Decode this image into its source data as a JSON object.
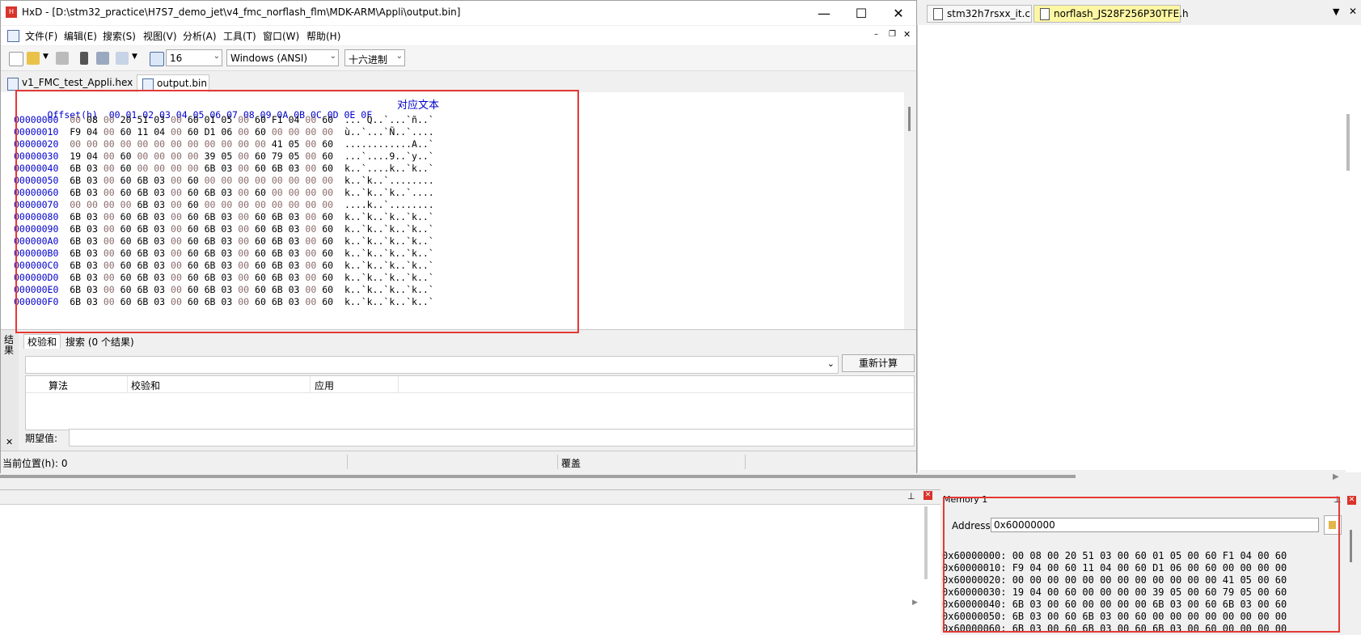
{
  "hxd": {
    "title": "HxD - [D:\\stm32_practice\\H7S7_demo_jet\\v4_fmc_norflash_flm\\MDK-ARM\\Appli\\output.bin]",
    "minimize": "—",
    "maximize": "☐",
    "close": "✕",
    "menu": [
      "文件(F)",
      "编辑(E)",
      "搜索(S)",
      "视图(V)",
      "分析(A)",
      "工具(T)",
      "窗口(W)",
      "帮助(H)"
    ],
    "bytes_per_row": "16",
    "encoding": "Windows (ANSI)",
    "number_base": "十六进制",
    "tabs": [
      "v1_FMC_test_Appli.hex",
      "output.bin"
    ],
    "hex_header": {
      "offset": "Offset(h)",
      "cols": "00 01 02 03 04 05 06 07 08 09 0A 0B 0C 0D 0E 0F",
      "text": "对应文本"
    },
    "rows": [
      {
        "off": "00000000",
        "hex": [
          "00",
          "08",
          "00",
          "20",
          "51",
          "03",
          "00",
          "60",
          "01",
          "05",
          "00",
          "60",
          "F1",
          "04",
          "00",
          "60"
        ],
        "txt": "... Q..`...`ñ..`"
      },
      {
        "off": "00000010",
        "hex": [
          "F9",
          "04",
          "00",
          "60",
          "11",
          "04",
          "00",
          "60",
          "D1",
          "06",
          "00",
          "60",
          "00",
          "00",
          "00",
          "00"
        ],
        "txt": "ù..`...`Ñ..`...."
      },
      {
        "off": "00000020",
        "hex": [
          "00",
          "00",
          "00",
          "00",
          "00",
          "00",
          "00",
          "00",
          "00",
          "00",
          "00",
          "00",
          "41",
          "05",
          "00",
          "60"
        ],
        "txt": "............A..`"
      },
      {
        "off": "00000030",
        "hex": [
          "19",
          "04",
          "00",
          "60",
          "00",
          "00",
          "00",
          "00",
          "39",
          "05",
          "00",
          "60",
          "79",
          "05",
          "00",
          "60"
        ],
        "txt": "...`....9..`y..`"
      },
      {
        "off": "00000040",
        "hex": [
          "6B",
          "03",
          "00",
          "60",
          "00",
          "00",
          "00",
          "00",
          "6B",
          "03",
          "00",
          "60",
          "6B",
          "03",
          "00",
          "60"
        ],
        "txt": "k..`....k..`k..`"
      },
      {
        "off": "00000050",
        "hex": [
          "6B",
          "03",
          "00",
          "60",
          "6B",
          "03",
          "00",
          "60",
          "00",
          "00",
          "00",
          "00",
          "00",
          "00",
          "00",
          "00"
        ],
        "txt": "k..`k..`........"
      },
      {
        "off": "00000060",
        "hex": [
          "6B",
          "03",
          "00",
          "60",
          "6B",
          "03",
          "00",
          "60",
          "6B",
          "03",
          "00",
          "60",
          "00",
          "00",
          "00",
          "00"
        ],
        "txt": "k..`k..`k..`...."
      },
      {
        "off": "00000070",
        "hex": [
          "00",
          "00",
          "00",
          "00",
          "6B",
          "03",
          "00",
          "60",
          "00",
          "00",
          "00",
          "00",
          "00",
          "00",
          "00",
          "00"
        ],
        "txt": "....k..`........"
      },
      {
        "off": "00000080",
        "hex": [
          "6B",
          "03",
          "00",
          "60",
          "6B",
          "03",
          "00",
          "60",
          "6B",
          "03",
          "00",
          "60",
          "6B",
          "03",
          "00",
          "60"
        ],
        "txt": "k..`k..`k..`k..`"
      },
      {
        "off": "00000090",
        "hex": [
          "6B",
          "03",
          "00",
          "60",
          "6B",
          "03",
          "00",
          "60",
          "6B",
          "03",
          "00",
          "60",
          "6B",
          "03",
          "00",
          "60"
        ],
        "txt": "k..`k..`k..`k..`"
      },
      {
        "off": "000000A0",
        "hex": [
          "6B",
          "03",
          "00",
          "60",
          "6B",
          "03",
          "00",
          "60",
          "6B",
          "03",
          "00",
          "60",
          "6B",
          "03",
          "00",
          "60"
        ],
        "txt": "k..`k..`k..`k..`"
      },
      {
        "off": "000000B0",
        "hex": [
          "6B",
          "03",
          "00",
          "60",
          "6B",
          "03",
          "00",
          "60",
          "6B",
          "03",
          "00",
          "60",
          "6B",
          "03",
          "00",
          "60"
        ],
        "txt": "k..`k..`k..`k..`"
      },
      {
        "off": "000000C0",
        "hex": [
          "6B",
          "03",
          "00",
          "60",
          "6B",
          "03",
          "00",
          "60",
          "6B",
          "03",
          "00",
          "60",
          "6B",
          "03",
          "00",
          "60"
        ],
        "txt": "k..`k..`k..`k..`"
      },
      {
        "off": "000000D0",
        "hex": [
          "6B",
          "03",
          "00",
          "60",
          "6B",
          "03",
          "00",
          "60",
          "6B",
          "03",
          "00",
          "60",
          "6B",
          "03",
          "00",
          "60"
        ],
        "txt": "k..`k..`k..`k..`"
      },
      {
        "off": "000000E0",
        "hex": [
          "6B",
          "03",
          "00",
          "60",
          "6B",
          "03",
          "00",
          "60",
          "6B",
          "03",
          "00",
          "60",
          "6B",
          "03",
          "00",
          "60"
        ],
        "txt": "k..`k..`k..`k..`"
      },
      {
        "off": "000000F0",
        "hex": [
          "6B",
          "03",
          "00",
          "60",
          "6B",
          "03",
          "00",
          "60",
          "6B",
          "03",
          "00",
          "60",
          "6B",
          "03",
          "00",
          "60"
        ],
        "txt": "k..`k..`k..`k..`"
      }
    ],
    "results": {
      "side_label": "结果",
      "tabs": [
        "校验和",
        "搜索 (0 个结果)"
      ],
      "recalc": "重新计算",
      "cols": [
        "算法",
        "校验和",
        "应用"
      ],
      "expected_label": "期望值:"
    },
    "status": {
      "position": "当前位置(h): 0",
      "mode": "覆盖"
    }
  },
  "editor": {
    "tabs": [
      "stm32h7rsxx_it.c",
      "norflash_JS28F256P30TFE.h"
    ]
  },
  "memory": {
    "title": "Memory 1",
    "address_label": "Address:",
    "address_value": "0x60000000",
    "rows": [
      "0x60000000: 00 08 00 20 51 03 00 60 01 05 00 60 F1 04 00 60",
      "0x60000010: F9 04 00 60 11 04 00 60 D1 06 00 60 00 00 00 00",
      "0x60000020: 00 00 00 00 00 00 00 00 00 00 00 00 41 05 00 60",
      "0x60000030: 19 04 00 60 00 00 00 00 39 05 00 60 79 05 00 60",
      "0x60000040: 6B 03 00 60 00 00 00 00 6B 03 00 60 6B 03 00 60",
      "0x60000050: 6B 03 00 60 6B 03 00 60 00 00 00 00 00 00 00 00",
      "0x60000060: 6B 03 00 60 6B 03 00 60 6B 03 00 60 00 00 00 00"
    ]
  }
}
